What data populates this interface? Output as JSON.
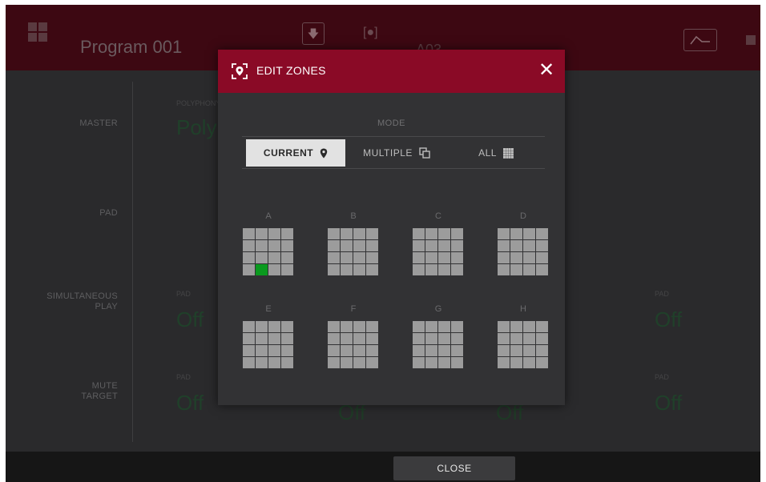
{
  "header": {
    "title": "Program 001",
    "pad_name": "A03",
    "download_icon": "download-icon",
    "zone_icon": "zone-target-icon",
    "envelope_icon": "envelope-icon"
  },
  "sidebar": {
    "items": [
      {
        "label": "MASTER"
      },
      {
        "label": "PAD"
      },
      {
        "label": "SIMULTANEOUS\nPLAY"
      },
      {
        "label": "MUTE\nTARGET"
      }
    ]
  },
  "background": {
    "poly_label": "POLYPHONY",
    "poly_value": "Poly",
    "pad_label": "PAD",
    "values": [
      "Off",
      "Off",
      "Off",
      "Off",
      "Off",
      "Off"
    ]
  },
  "modal": {
    "title": "EDIT ZONES",
    "close_icon": "close-icon",
    "mode_label": "MODE",
    "modes": [
      {
        "label": "CURRENT",
        "icon": "pin-icon",
        "active": true
      },
      {
        "label": "MULTIPLE",
        "icon": "copy-icon",
        "active": false
      },
      {
        "label": "ALL",
        "icon": "grid-icon",
        "active": false
      }
    ],
    "zones": [
      {
        "label": "A"
      },
      {
        "label": "B"
      },
      {
        "label": "C"
      },
      {
        "label": "D"
      },
      {
        "label": "E"
      },
      {
        "label": "F"
      },
      {
        "label": "G"
      },
      {
        "label": "H"
      }
    ],
    "selected": {
      "zone": "A",
      "pad_index": 13
    },
    "selected_color": "#0a9a1e",
    "accent_color": "#8a0a26"
  },
  "footer": {
    "close_label": "CLOSE"
  }
}
